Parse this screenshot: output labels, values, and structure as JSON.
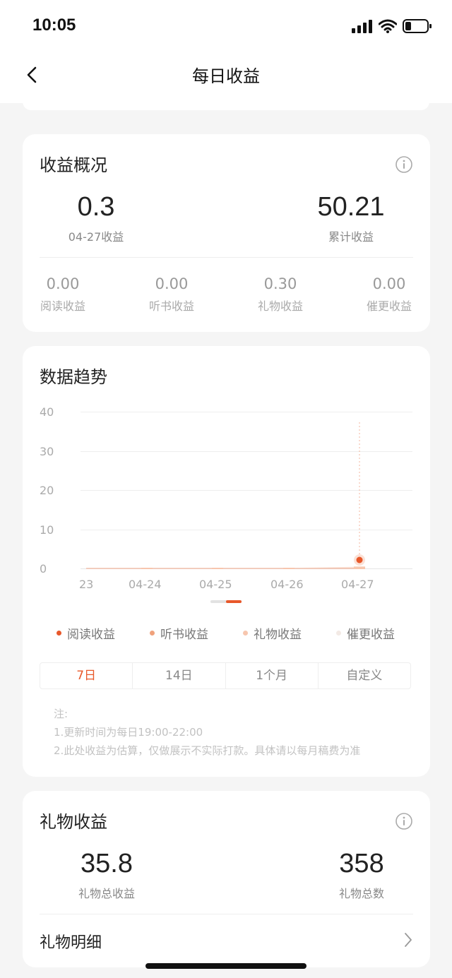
{
  "status_bar": {
    "time": "10:05"
  },
  "nav": {
    "title": "每日收益",
    "back_icon": "chevron-left-icon"
  },
  "overview": {
    "title": "收益概况",
    "today_value": "0.3",
    "today_label": "04-27收益",
    "total_value": "50.21",
    "total_label": "累计收益",
    "breakdown": [
      {
        "value": "0.00",
        "label": "阅读收益"
      },
      {
        "value": "0.00",
        "label": "听书收益"
      },
      {
        "value": "0.30",
        "label": "礼物收益"
      },
      {
        "value": "0.00",
        "label": "催更收益"
      }
    ]
  },
  "trend": {
    "title": "数据趋势",
    "legend": [
      {
        "label": "阅读收益",
        "color": "#e8582a"
      },
      {
        "label": "听书收益",
        "color": "#f0a27c"
      },
      {
        "label": "礼物收益",
        "color": "#f7c6ae"
      },
      {
        "label": "催更收益",
        "color": "#f3eae5"
      }
    ],
    "tabs": [
      "7日",
      "14日",
      "1个月",
      "自定义"
    ],
    "active_tab": 0,
    "notes": [
      "注:",
      "1.更新时间为每日19:00-22:00",
      "2.此处收益为估算，仅做展示不实际打款。具体请以每月稿费为准"
    ]
  },
  "chart_data": {
    "type": "line",
    "categories": [
      "23",
      "04-24",
      "04-25",
      "04-26",
      "04-27"
    ],
    "y_ticks": [
      "0",
      "10",
      "20",
      "30",
      "40"
    ],
    "ylim": [
      0,
      40
    ],
    "series": [
      {
        "name": "阅读收益",
        "values": [
          0,
          0,
          0,
          0,
          0
        ]
      },
      {
        "name": "听书收益",
        "values": [
          0,
          0,
          0,
          0,
          0
        ]
      },
      {
        "name": "礼物收益",
        "values": [
          0,
          0,
          0,
          0,
          0.3
        ]
      },
      {
        "name": "催更收益",
        "values": [
          0,
          0,
          0,
          0,
          0
        ]
      }
    ],
    "highlight_category": "04-27",
    "grid": true
  },
  "gift": {
    "title": "礼物收益",
    "total_income_value": "35.8",
    "total_income_label": "礼物总收益",
    "total_count_value": "358",
    "total_count_label": "礼物总数",
    "detail_label": "礼物明细"
  },
  "colors": {
    "accent": "#e8582a"
  }
}
